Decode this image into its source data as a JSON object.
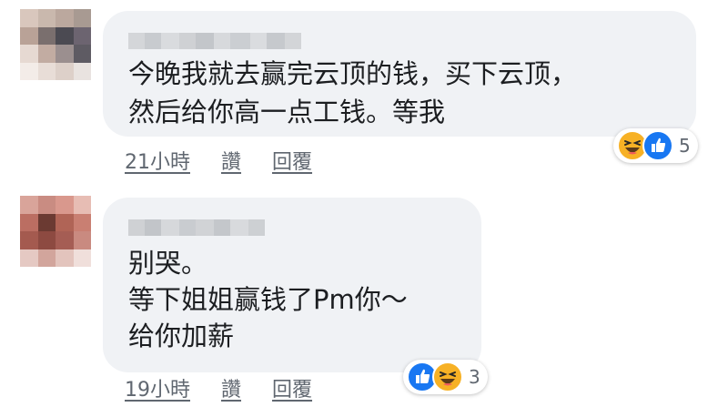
{
  "comments": [
    {
      "text": "今晚我就去赢完云顶的钱，买下云顶，\n然后给你高一点工钱。等我",
      "time": "21小時",
      "like_label": "讚",
      "reply_label": "回覆",
      "reaction_count": "5",
      "reaction_icons": [
        "haha-icon",
        "like-icon"
      ]
    },
    {
      "text": "别哭。\n等下姐姐赢钱了Pm你～\n给你加薪",
      "time": "19小時",
      "like_label": "讚",
      "reply_label": "回覆",
      "reaction_count": "3",
      "reaction_icons": [
        "like-icon",
        "haha-icon"
      ]
    }
  ],
  "colors": {
    "bubble": "#f0f2f5",
    "text": "#1c1e21",
    "meta": "#606770",
    "like_blue": "#1877f2",
    "haha_yellow": "#f7b125"
  }
}
